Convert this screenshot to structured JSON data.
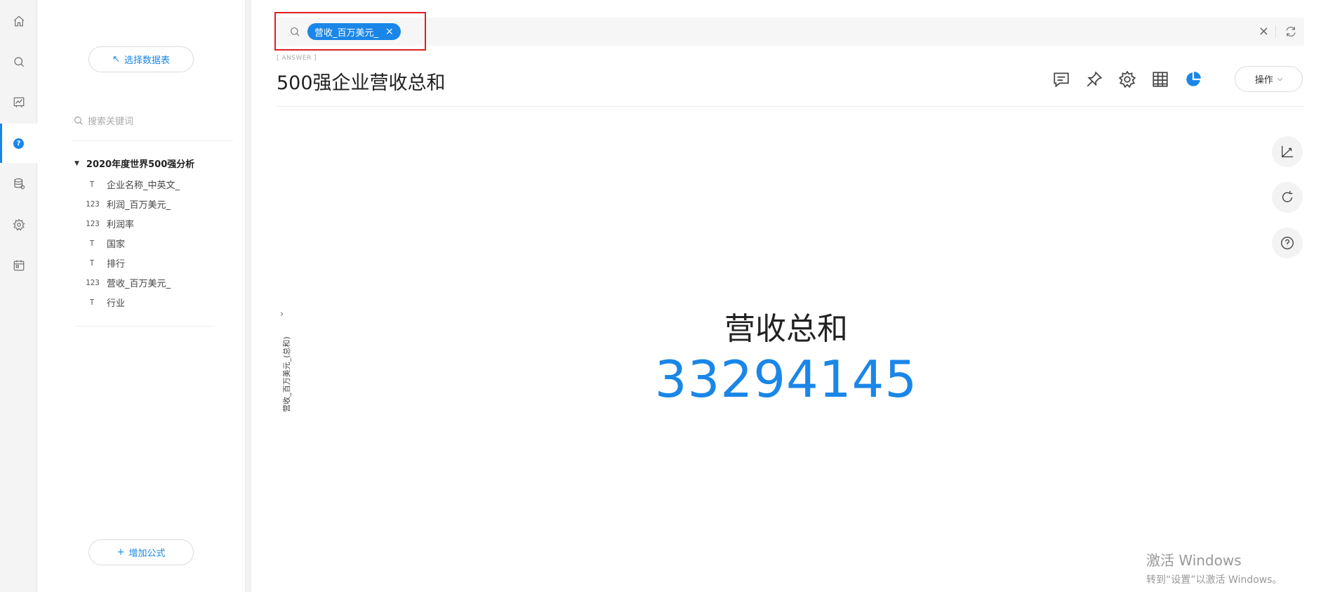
{
  "rail": {
    "items": [
      {
        "icon": "home-icon"
      },
      {
        "icon": "search-icon"
      },
      {
        "icon": "dashboard-icon"
      },
      {
        "icon": "help-icon",
        "active": true
      },
      {
        "icon": "database-icon"
      },
      {
        "icon": "gear-icon"
      },
      {
        "icon": "calendar-icon"
      }
    ]
  },
  "panel": {
    "select_table_label": "选择数据表",
    "select_table_icon": "↖",
    "search_placeholder": "搜索关键词",
    "table_name": "2020年度世界500强分析",
    "fields": [
      {
        "type_glyph": "T",
        "name": "企业名称_中英文_"
      },
      {
        "type_glyph": "123",
        "name": "利润_百万美元_"
      },
      {
        "type_glyph": "123",
        "name": "利润率"
      },
      {
        "type_glyph": "T",
        "name": "国家"
      },
      {
        "type_glyph": "T",
        "name": "排行"
      },
      {
        "type_glyph": "123",
        "name": "营收_百万美元_"
      },
      {
        "type_glyph": "T",
        "name": "行业"
      }
    ],
    "add_formula_label": "增加公式",
    "add_formula_icon": "+"
  },
  "query": {
    "token_label": "营收_百万美元_",
    "token_close": "×",
    "clear": "×"
  },
  "answer": {
    "tag": "[ ANSWER ]",
    "title": "500强企业营收总和",
    "ops_label": "操作",
    "axis_label": "营收_百万美元_(总和)",
    "axis_arrow": "›",
    "kpi_label": "营收总和",
    "kpi_value": "33294145"
  },
  "colors": {
    "accent": "#1a86e8",
    "highlight": "#e02020"
  },
  "watermark": {
    "line1": "激活 Windows",
    "line2": "转到“设置”以激活 Windows。"
  }
}
